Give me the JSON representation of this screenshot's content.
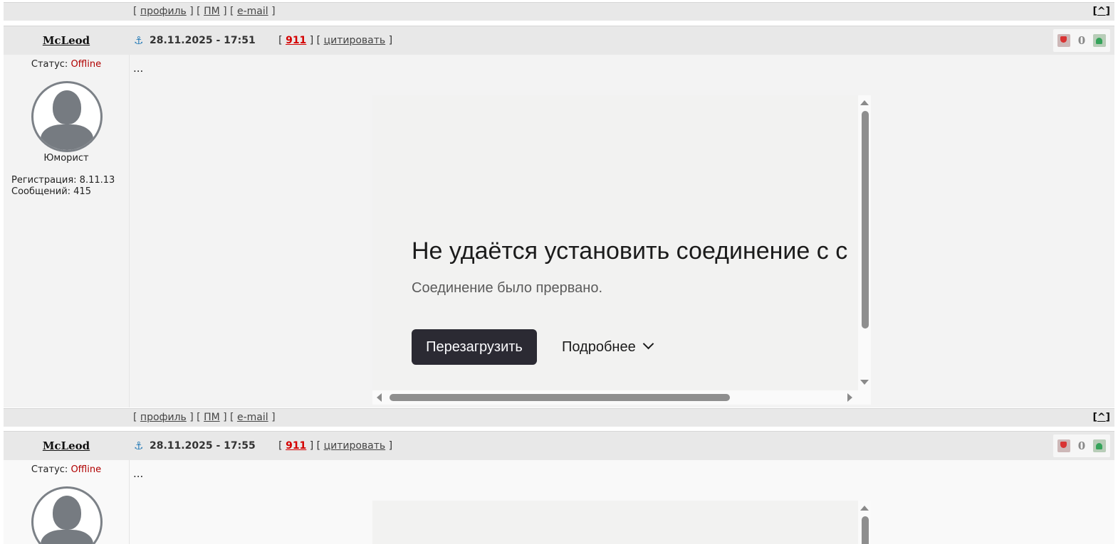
{
  "links_bar": {
    "open": "[",
    "sep": "] [",
    "close": "]",
    "profile": "профиль",
    "pm": "ПМ",
    "email": "e-mail",
    "to_top": "^"
  },
  "posts": [
    {
      "author": "McLeod",
      "date": "28.11.2025 - 17:51",
      "post_number": "911",
      "quote_label": "цитировать",
      "rating": "0",
      "status_label": "Статус:",
      "status_value": "Offline",
      "rank": "Юморист",
      "registration": "Регистрация: 8.11.13",
      "messages": "Сообщений: 415",
      "text": "..."
    },
    {
      "author": "McLeod",
      "date": "28.11.2025 - 17:55",
      "post_number": "911",
      "quote_label": "цитировать",
      "rating": "0",
      "status_label": "Статус:",
      "status_value": "Offline",
      "text": "..."
    }
  ],
  "embed_error": {
    "title": "Не удаётся установить соединение с с",
    "subtitle": "Соединение было прервано.",
    "reload_label": "Перезагрузить",
    "more_label": "Подробнее"
  },
  "colors": {
    "offline": "#b00000",
    "post_number": "#d40000",
    "reload_button": "#2b2a33"
  }
}
